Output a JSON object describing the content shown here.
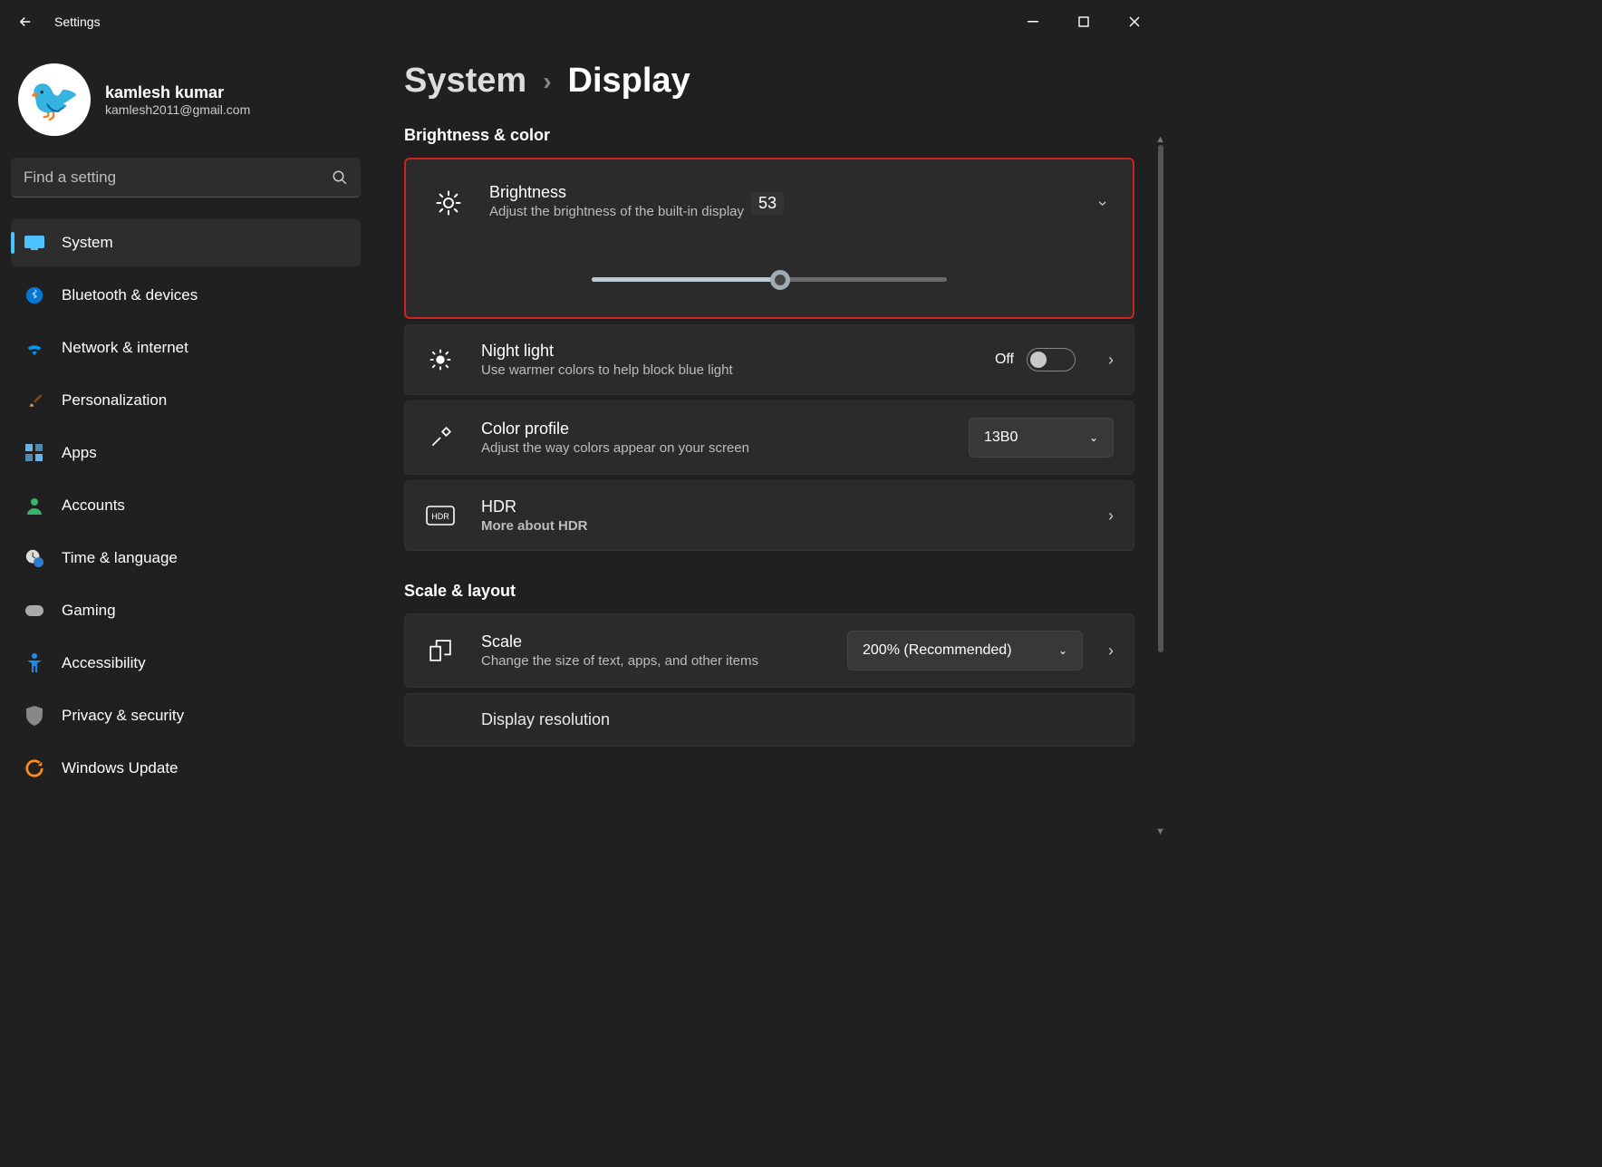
{
  "titlebar": {
    "title": "Settings"
  },
  "profile": {
    "name": "kamlesh kumar",
    "email": "kamlesh2011@gmail.com"
  },
  "search": {
    "placeholder": "Find a setting"
  },
  "sidebar": {
    "items": [
      {
        "label": "System"
      },
      {
        "label": "Bluetooth & devices"
      },
      {
        "label": "Network & internet"
      },
      {
        "label": "Personalization"
      },
      {
        "label": "Apps"
      },
      {
        "label": "Accounts"
      },
      {
        "label": "Time & language"
      },
      {
        "label": "Gaming"
      },
      {
        "label": "Accessibility"
      },
      {
        "label": "Privacy & security"
      },
      {
        "label": "Windows Update"
      }
    ]
  },
  "breadcrumb": {
    "parent": "System",
    "current": "Display"
  },
  "sections": {
    "brightness_color": {
      "heading": "Brightness & color"
    },
    "scale_layout": {
      "heading": "Scale & layout"
    }
  },
  "brightness": {
    "title": "Brightness",
    "subtitle": "Adjust the brightness of the built-in display",
    "value": "53"
  },
  "night_light": {
    "title": "Night light",
    "subtitle": "Use warmer colors to help block blue light",
    "state": "Off"
  },
  "color_profile": {
    "title": "Color profile",
    "subtitle": "Adjust the way colors appear on your screen",
    "selected": "13B0"
  },
  "hdr": {
    "title": "HDR",
    "subtitle": "More about HDR"
  },
  "scale": {
    "title": "Scale",
    "subtitle": "Change the size of text, apps, and other items",
    "selected": "200% (Recommended)"
  },
  "display_resolution": {
    "title": "Display resolution"
  }
}
